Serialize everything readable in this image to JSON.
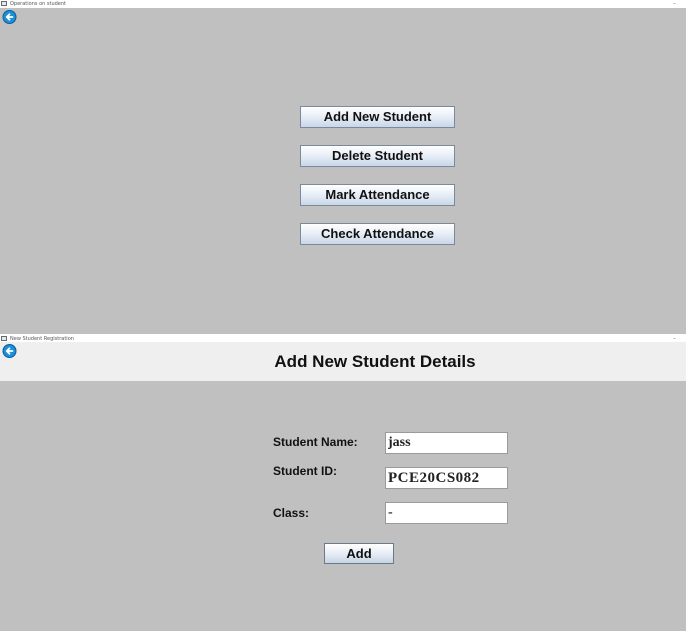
{
  "operations_window": {
    "title": "Operations on student",
    "minimize_label": "–",
    "buttons": {
      "add_student": "Add New Student",
      "delete_student": "Delete Student",
      "mark_attendance": "Mark Attendance",
      "check_attendance": "Check Attendance"
    }
  },
  "add_student_window": {
    "title": "New Student Registration",
    "minimize_label": "–",
    "heading": "Add New Student Details",
    "labels": {
      "name": "Student Name:",
      "id": "Student ID:",
      "class": "Class:"
    },
    "fields": {
      "name": "jass",
      "id": "PCE20CS082",
      "class": "-"
    },
    "add_button": "Add"
  },
  "icons": {
    "back": "back-arrow-icon",
    "window": "window-icon"
  },
  "colors": {
    "background": "#c0c0c0",
    "header_band": "#efefef",
    "back_icon": "#1b8fd8"
  }
}
